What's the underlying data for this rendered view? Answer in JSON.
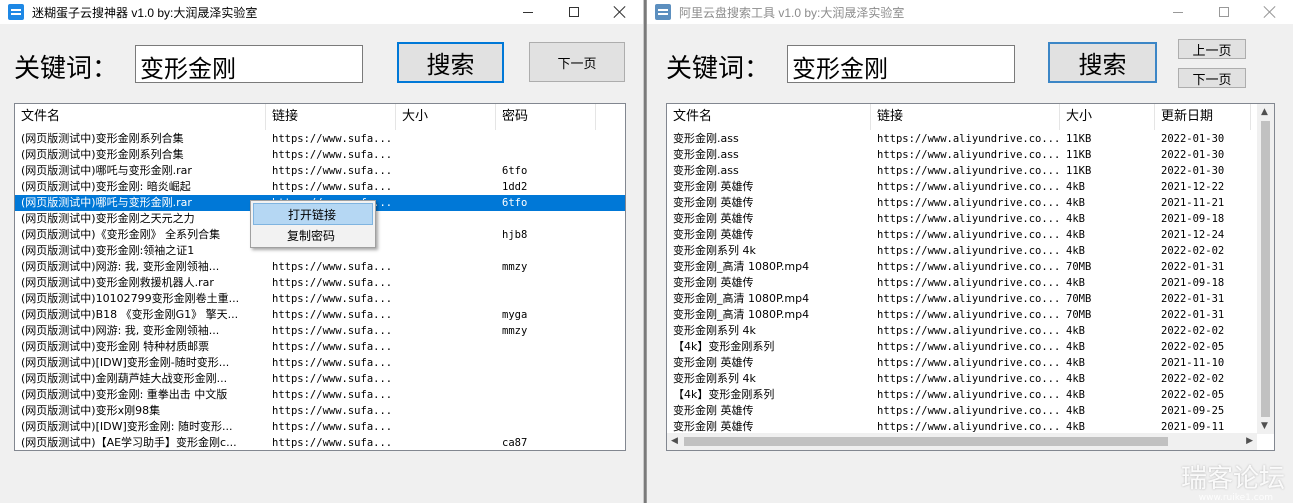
{
  "win1": {
    "title": "迷糊蛋子云搜神器 v1.0  by:大润晟泽实验室",
    "keyword_label": "关键词：",
    "keyword_value": "变形金刚",
    "search_label": "搜索",
    "next_label": "下一页",
    "columns": [
      "文件名",
      "链接",
      "大小",
      "密码"
    ],
    "rows": [
      [
        "(网页版测试中)变形金刚系列合集",
        "https://www.sufa...",
        "",
        ""
      ],
      [
        "(网页版测试中)变形金刚系列合集",
        "https://www.sufa...",
        "",
        ""
      ],
      [
        "(网页版测试中)哪吒与变形金刚.rar",
        "https://www.sufa...",
        "",
        "6tfo"
      ],
      [
        "(网页版测试中)变形金刚: 暗炎崛起",
        "https://www.sufa...",
        "",
        "1dd2"
      ],
      [
        "(网页版测试中)哪吒与变形金刚.rar",
        "https://www.sufa...",
        "",
        "6tfo"
      ],
      [
        "(网页版测试中)变形金刚之天元之力",
        "",
        "",
        ""
      ],
      [
        "(网页版测试中)《变形金刚》 全系列合集",
        "",
        "",
        "hjb8"
      ],
      [
        "(网页版测试中)变形金刚:领袖之证1",
        "",
        "",
        ""
      ],
      [
        "(网页版测试中)网游: 我, 变形金刚领袖...",
        "https://www.sufa...",
        "",
        "mmzy"
      ],
      [
        "(网页版测试中)变形金刚救援机器人.rar",
        "https://www.sufa...",
        "",
        ""
      ],
      [
        "(网页版测试中)10102799变形金刚卷土重...",
        "https://www.sufa...",
        "",
        ""
      ],
      [
        "(网页版测试中)B18 《变形金刚G1》 擎天...",
        "https://www.sufa...",
        "",
        "myga"
      ],
      [
        "(网页版测试中)网游: 我, 变形金刚领袖...",
        "https://www.sufa...",
        "",
        "mmzy"
      ],
      [
        "(网页版测试中)变形金刚 特种材质邮票",
        "https://www.sufa...",
        "",
        ""
      ],
      [
        "(网页版测试中)[IDW]变形金刚-随时变形...",
        "https://www.sufa...",
        "",
        ""
      ],
      [
        "(网页版测试中)金刚葫芦娃大战变形金刚...",
        "https://www.sufa...",
        "",
        ""
      ],
      [
        "(网页版测试中)变形金刚: 重拳出击 中文版",
        "https://www.sufa...",
        "",
        ""
      ],
      [
        "(网页版测试中)变形x刚98集",
        "https://www.sufa...",
        "",
        ""
      ],
      [
        "(网页版测试中)[IDW]变形金刚: 随时变形...",
        "https://www.sufa...",
        "",
        ""
      ],
      [
        "(网页版测试中)【AE学习助手】变形金刚c...",
        "https://www.sufa...",
        "",
        "ca87"
      ]
    ],
    "context_menu": [
      "打开链接",
      "复制密码"
    ]
  },
  "win2": {
    "title": "阿里云盘搜索工具 v1.0  by:大润晟泽实验室",
    "keyword_label": "关键词：",
    "keyword_value": "变形金刚",
    "search_label": "搜索",
    "prev_label": "上一页",
    "next_label": "下一页",
    "columns": [
      "文件名",
      "链接",
      "大小",
      "更新日期"
    ],
    "rows": [
      [
        "变形金刚.ass",
        "https://www.aliyundrive.co...",
        "11KB",
        "2022-01-30"
      ],
      [
        "变形金刚.ass",
        "https://www.aliyundrive.co...",
        "11KB",
        "2022-01-30"
      ],
      [
        "变形金刚.ass",
        "https://www.aliyundrive.co...",
        "11KB",
        "2022-01-30"
      ],
      [
        "变形金刚 英雄传",
        "https://www.aliyundrive.co...",
        "4kB",
        "2021-12-22"
      ],
      [
        "变形金刚 英雄传",
        "https://www.aliyundrive.co...",
        "4kB",
        "2021-11-21"
      ],
      [
        "变形金刚 英雄传",
        "https://www.aliyundrive.co...",
        "4kB",
        "2021-09-18"
      ],
      [
        "变形金刚 英雄传",
        "https://www.aliyundrive.co...",
        "4kB",
        "2021-12-24"
      ],
      [
        "变形金刚系列  4k",
        "https://www.aliyundrive.co...",
        "4kB",
        "2022-02-02"
      ],
      [
        "变形金刚_高清 1080P.mp4",
        "https://www.aliyundrive.co...",
        "70MB",
        "2022-01-31"
      ],
      [
        "变形金刚 英雄传",
        "https://www.aliyundrive.co...",
        "4kB",
        "2021-09-18"
      ],
      [
        "变形金刚_高清 1080P.mp4",
        "https://www.aliyundrive.co...",
        "70MB",
        "2022-01-31"
      ],
      [
        "变形金刚_高清 1080P.mp4",
        "https://www.aliyundrive.co...",
        "70MB",
        "2022-01-31"
      ],
      [
        "变形金刚系列  4k",
        "https://www.aliyundrive.co...",
        "4kB",
        "2022-02-02"
      ],
      [
        "【4k】变形金刚系列",
        "https://www.aliyundrive.co...",
        "4kB",
        "2022-02-05"
      ],
      [
        "变形金刚 英雄传",
        "https://www.aliyundrive.co...",
        "4kB",
        "2021-11-10"
      ],
      [
        "变形金刚系列  4k",
        "https://www.aliyundrive.co...",
        "4kB",
        "2022-02-02"
      ],
      [
        "【4k】变形金刚系列",
        "https://www.aliyundrive.co...",
        "4kB",
        "2022-02-05"
      ],
      [
        "变形金刚 英雄传",
        "https://www.aliyundrive.co...",
        "4kB",
        "2021-09-25"
      ],
      [
        "变形金刚 英雄传",
        "https://www.aliyundrive.co...",
        "4kB",
        "2021-09-11"
      ]
    ]
  },
  "watermark": {
    "main": "瑞客论坛",
    "sub": "www.ruike1.com"
  },
  "colors": {
    "selection": "#0078d7",
    "menu_hover": "#b5d7f3",
    "button_focus": "#0078d7"
  },
  "icons": [
    "app-icon",
    "minimize-icon",
    "maximize-icon",
    "close-icon"
  ]
}
